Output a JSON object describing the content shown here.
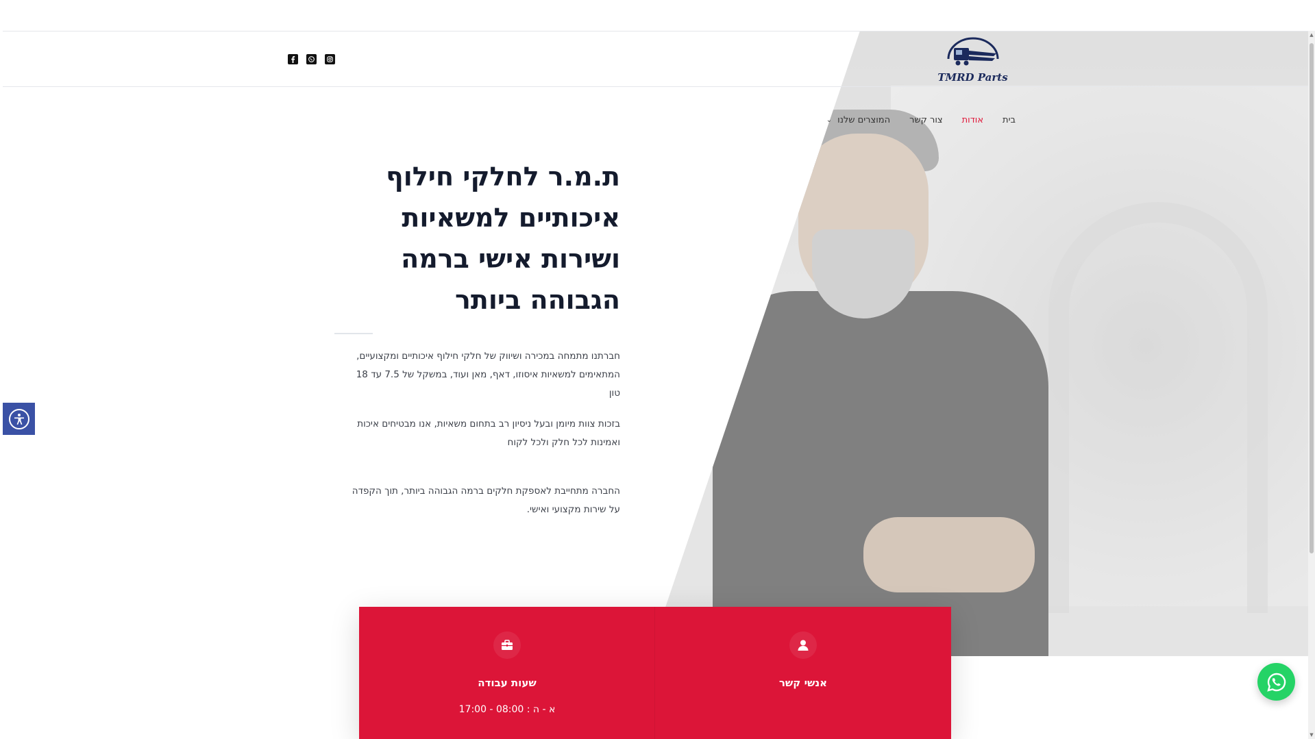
{
  "logo": {
    "text": "TMRD Parts"
  },
  "nav": {
    "items": [
      {
        "label": "בית"
      },
      {
        "label": "אודות"
      },
      {
        "label": "צור קשר"
      },
      {
        "label": "המוצרים שלנו"
      }
    ],
    "active_index": 1
  },
  "social": {
    "icons": [
      "facebook-icon",
      "whatsapp-icon",
      "instagram-icon"
    ]
  },
  "hero": {
    "headline_lines": [
      "ת.מ.ר לחלקי חילוף",
      "איכותיים למשאיות",
      "ושירות אישי ברמה",
      "הגבוהה ביותר"
    ],
    "para1": "חברתנו מתמחה במכירה ושיווק של חלקי חילוף איכותיים ומקצועיים, המתאימים למשאיות איסוזו, דאף, מאן ועוד, במשקל של 7.5 עד 18 טון",
    "para2": "בזכות צוות מיומן ובעל ניסיון רב בתחום משאיות, אנו מבטיחים איכות ואמינות לכל חלק ולכל לקוח",
    "para3": "החברה מתחייבת לאספקת חלקים ברמה הגבוהה ביותר, תוך הקפדה על שירות מקצועי ואישי."
  },
  "info": {
    "hours_title": "שעות עבודה",
    "hours_text": "א - ה : 08:00 - 17:00",
    "contacts_title": "אנשי קשר"
  },
  "colors": {
    "accent": "#e01b3c",
    "panel": "#dc1538",
    "a11y": "#3a51a5",
    "whatsapp": "#25d366"
  }
}
